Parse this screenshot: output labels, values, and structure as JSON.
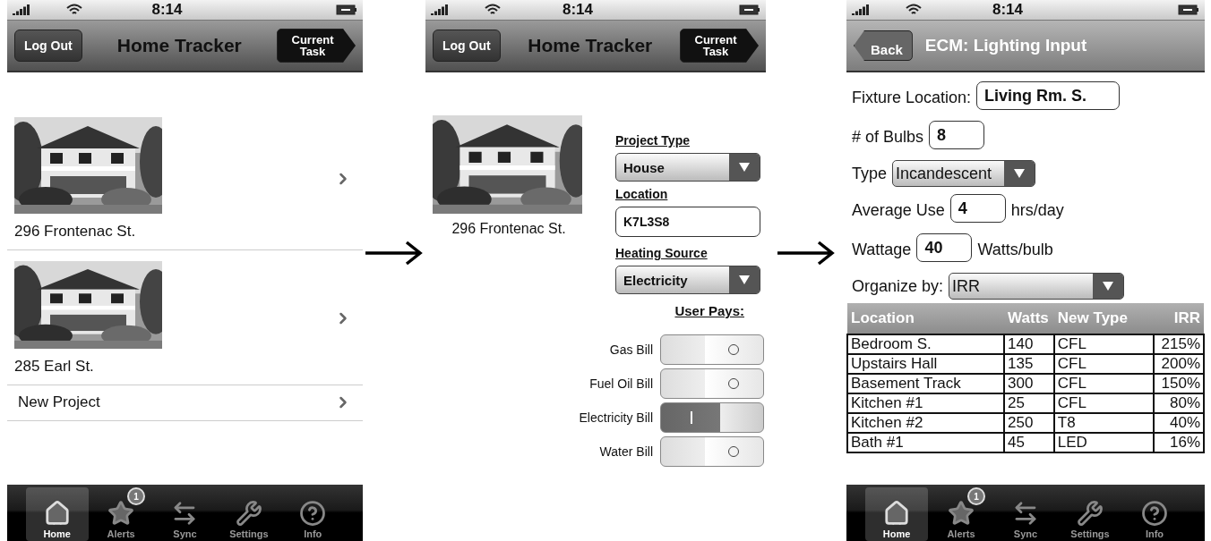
{
  "screens": [
    {
      "kind": "list",
      "status": {
        "time": "8:14"
      },
      "nav": {
        "left_button": {
          "label": "Log Out",
          "kind": "plain"
        },
        "title": "Home Tracker",
        "right_button": {
          "label": "Current Task",
          "kind": "forward"
        }
      },
      "projects": [
        {
          "label": "296 Frontenac St."
        },
        {
          "label": "285 Earl St."
        },
        {
          "kind": "plain",
          "label": "New Project"
        }
      ],
      "tab_bar": [
        {
          "label": "Home",
          "selected": true
        },
        {
          "label": "Alerts",
          "selected": false,
          "badge": "1"
        },
        {
          "label": "Sync",
          "selected": false
        },
        {
          "label": "Settings",
          "selected": false
        },
        {
          "label": "Info",
          "selected": false
        }
      ]
    },
    {
      "kind": "details",
      "status": {
        "time": "8:14"
      },
      "nav": {
        "left_button": {
          "label": "Log Out",
          "kind": "plain"
        },
        "title": "Home Tracker",
        "right_button": {
          "label": "Current Task",
          "kind": "forward"
        }
      },
      "project": {
        "label": "296 Frontenac St."
      },
      "fields": [
        {
          "kind": "select",
          "heading": "Project Type",
          "value": "House"
        },
        {
          "kind": "input",
          "heading": "Location",
          "value": "K7L3S8"
        },
        {
          "kind": "select",
          "heading": "Heating Source",
          "value": "Electricity"
        }
      ],
      "toggles_heading": "User Pays:",
      "toggles": [
        {
          "label": "Gas Bill",
          "on": false
        },
        {
          "label": "Fuel Oil Bill",
          "on": false
        },
        {
          "label": "Electricity Bill",
          "on": true
        },
        {
          "label": "Water Bill",
          "on": false
        }
      ]
    },
    {
      "kind": "form",
      "status": {
        "time": "8:14"
      },
      "nav": {
        "left_button": {
          "label": "Back",
          "kind": "back"
        },
        "title": "ECM: Lighting Input"
      },
      "fields": [
        {
          "kind": "input",
          "label": "Fixture Location:",
          "value": "Living Rm. S."
        },
        {
          "kind": "input",
          "label": "# of Bulbs",
          "value": "8"
        },
        {
          "kind": "select",
          "label": "Type",
          "value": "Incandescent"
        },
        {
          "kind": "input",
          "label": "Average Use",
          "value": "4",
          "unit": "hrs/day"
        },
        {
          "kind": "input",
          "label": "Wattage",
          "value": "40",
          "unit": "Watts/bulb"
        },
        {
          "kind": "select",
          "label": "Organize by:",
          "value": "IRR"
        }
      ],
      "table": {
        "columns": [
          "Location",
          "Watts",
          "New Type",
          "IRR"
        ],
        "rows": [
          [
            "Bedroom S.",
            "140",
            "CFL",
            "215%"
          ],
          [
            "Upstairs Hall",
            "135",
            "CFL",
            "200%"
          ],
          [
            "Basement Track",
            "300",
            "CFL",
            "150%"
          ],
          [
            "Kitchen #1",
            "25",
            "CFL",
            "80%"
          ],
          [
            "Kitchen #2",
            "250",
            "T8",
            "40%"
          ],
          [
            "Bath #1",
            "45",
            "LED",
            "16%"
          ]
        ]
      },
      "tab_bar": [
        {
          "label": "Home",
          "selected": true
        },
        {
          "label": "Alerts",
          "selected": false,
          "badge": "1"
        },
        {
          "label": "Sync",
          "selected": false
        },
        {
          "label": "Settings",
          "selected": false
        },
        {
          "label": "Info",
          "selected": false
        }
      ]
    }
  ]
}
